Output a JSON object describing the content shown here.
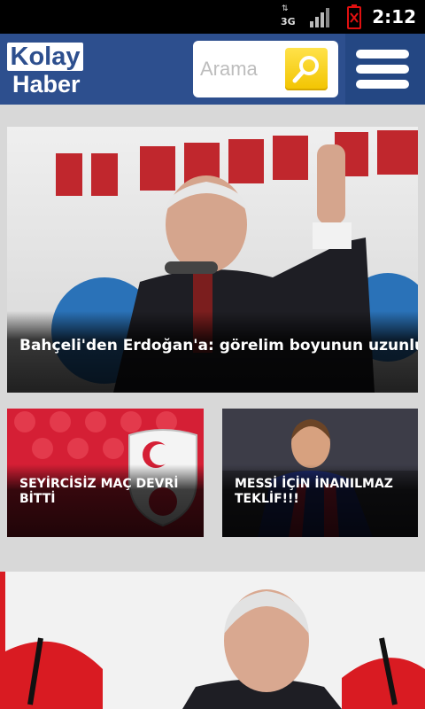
{
  "status_bar": {
    "time": "2:12",
    "network_label": "3G",
    "icons": [
      "3g-data-icon",
      "signal-icon",
      "battery-alert-icon"
    ]
  },
  "header": {
    "logo_line1": "Kolay",
    "logo_line2": "Haber",
    "search_placeholder": "Arama",
    "search_icon": "magnifier-icon",
    "menu_icon": "hamburger-menu-icon",
    "colors": {
      "header_bg": "#2d4f8e",
      "search_button": "#f2c400",
      "accent_red": "#d91b22"
    }
  },
  "news": {
    "hero": {
      "title": "Bahçeli'den Erdoğan'a: görelim boyunun uzunluğunu"
    },
    "tiles": [
      {
        "title": "SEYİRCİSİZ MAÇ DEVRİ BİTTİ"
      },
      {
        "title": "MESSİ İÇİN İNANILMAZ TEKLİF!!!"
      }
    ]
  }
}
